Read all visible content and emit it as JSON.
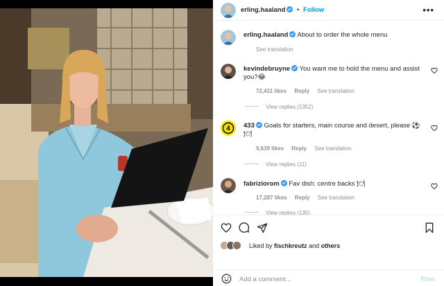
{
  "post": {
    "author": "erling.haaland",
    "follow_label": "Follow",
    "more_label": "•••",
    "caption": "About to order the whole menu",
    "see_translation": "See translation"
  },
  "comments": [
    {
      "username": "kevindebruyne",
      "text": "You want me to hold the menu and assist you?😂",
      "likes": "72,411 likes",
      "reply": "Reply",
      "see_translation": "See translation",
      "view_replies": "View replies (1352)"
    },
    {
      "username": "433",
      "text": "Goals for starters, main course and desert, please ⚽ 🍽",
      "likes": "9,639 likes",
      "reply": "Reply",
      "see_translation": "See translation",
      "view_replies": "View replies (11)"
    },
    {
      "username": "fabriziorom",
      "text": "Fav dish: centre backs 🍽",
      "likes": "17,287 likes",
      "reply": "Reply",
      "see_translation": "See translation",
      "view_replies": "View replies (135)"
    }
  ],
  "likes_summary": {
    "prefix": "Liked by",
    "user": "fischkreutz",
    "middle": "and",
    "suffix": "others"
  },
  "add_comment": {
    "placeholder": "Add a comment...",
    "post_label": "Post"
  },
  "colors": {
    "verified": "#3897f0",
    "follow": "#0095f6",
    "post_disabled": "#b2dffc",
    "badge_433": "#f5e100"
  },
  "icons": {
    "like": "heart-icon",
    "comment": "comment-icon",
    "share": "share-icon",
    "save": "bookmark-icon",
    "emoji": "emoji-icon",
    "more": "more-icon"
  }
}
